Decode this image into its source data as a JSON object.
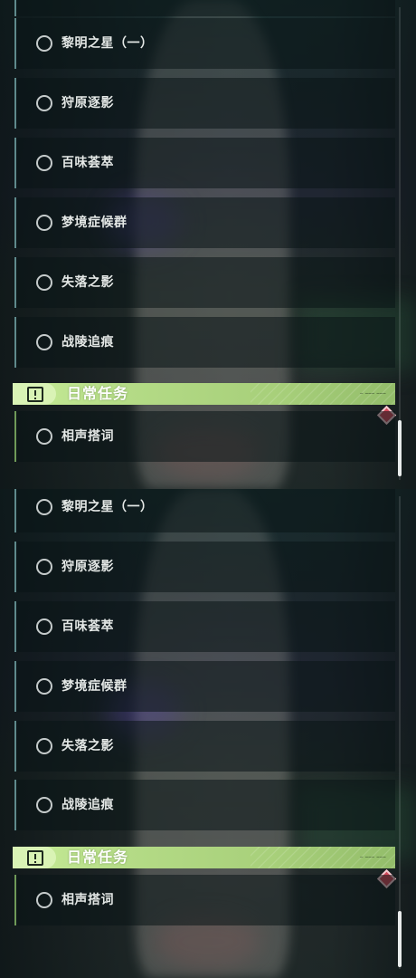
{
  "quests": [
    {
      "label": "黎明之星（一）"
    },
    {
      "label": "狩原逐影"
    },
    {
      "label": "百味荟萃"
    },
    {
      "label": "梦境症候群"
    },
    {
      "label": "失落之影"
    },
    {
      "label": "战陵追痕"
    }
  ],
  "daily": {
    "title": "日常任务",
    "icon": "alert-box-icon",
    "header_color": "#b4db86",
    "items": [
      {
        "label": "相声搭词"
      }
    ]
  },
  "marker": {
    "icon": "red-diamond-marker-icon",
    "color": "#d2495a"
  },
  "scroll": {
    "position": 0.95
  }
}
